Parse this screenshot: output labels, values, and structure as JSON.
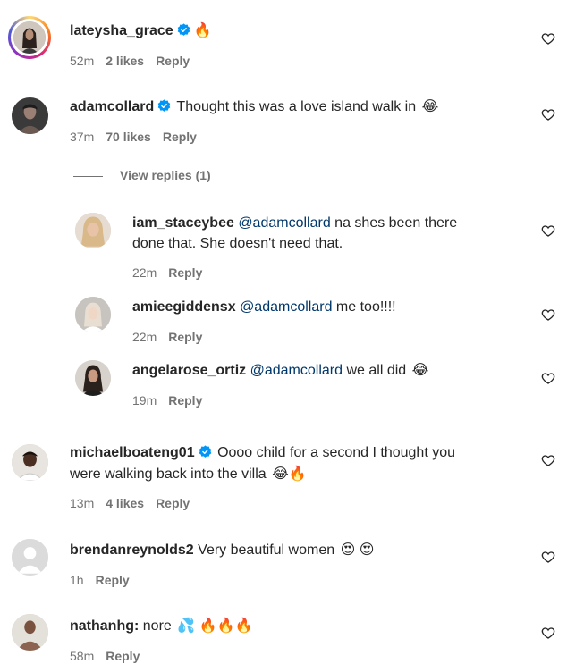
{
  "comments": [
    {
      "username": "lateysha_grace",
      "verified": true,
      "text": "",
      "emoji": "🔥",
      "time": "52m",
      "likes": "2 likes",
      "reply": "Reply"
    },
    {
      "username": "adamcollard",
      "verified": true,
      "text": "Thought this was a love island walk in",
      "emoji": "😂",
      "time": "37m",
      "likes": "70 likes",
      "reply": "Reply",
      "view_replies": "View replies (1)"
    },
    {
      "username": "iam_staceybee",
      "verified": false,
      "mention": "@adamcollard",
      "text": "na shes been there",
      "text_line2": "done that. She doesn't need that.",
      "time": "22m",
      "reply": "Reply"
    },
    {
      "username": "amieegiddensx",
      "verified": false,
      "mention": "@adamcollard",
      "text": "me too!!!!",
      "time": "22m",
      "reply": "Reply"
    },
    {
      "username": "angelarose_ortiz",
      "verified": false,
      "mention": "@adamcollard",
      "text": "we all did",
      "emoji": "😂",
      "time": "19m",
      "reply": "Reply"
    },
    {
      "username": "michaelboateng01",
      "verified": true,
      "text": "Oooo child for a second I thought you",
      "text_line2": "were walking back into the villa",
      "emoji": "😂🔥",
      "time": "13m",
      "likes": "4 likes",
      "reply": "Reply"
    },
    {
      "username": "brendanreynolds2",
      "verified": false,
      "text": "Very beautiful women",
      "emoji": "😍 😍",
      "time": "1h",
      "reply": "Reply"
    },
    {
      "username": "nathanhg:",
      "verified": false,
      "text": "nore",
      "emoji": "💦 🔥🔥🔥",
      "time": "58m",
      "reply": "Reply"
    }
  ],
  "colors": {
    "text": "#262626",
    "secondary": "#737373",
    "mention": "#00376b",
    "verified": "#0095f6"
  }
}
